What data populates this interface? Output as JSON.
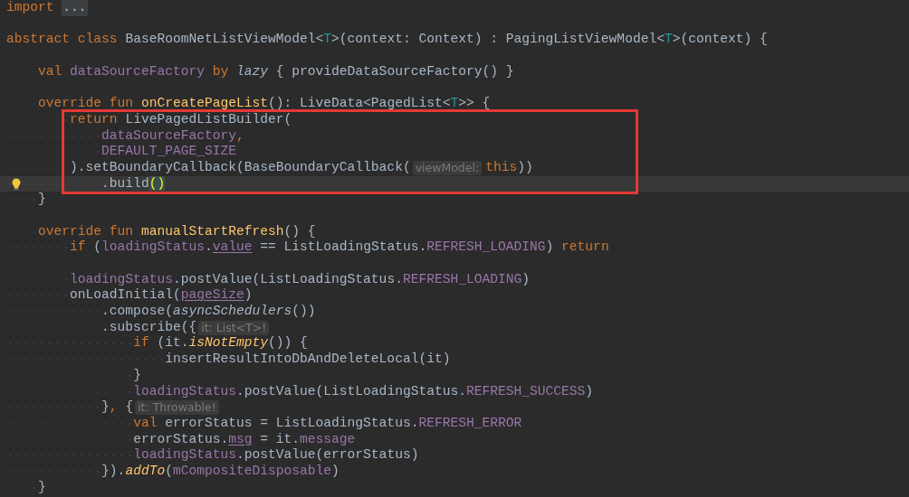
{
  "editor": {
    "blocks": [
      {
        "boxed": false,
        "lines": [
          {
            "current": false,
            "tokens": [
              {
                "kind": "keyword",
                "text": "import "
              },
              {
                "kind": "folded",
                "text": "..."
              }
            ]
          },
          {
            "current": false
          },
          {
            "current": false,
            "tokens": [
              {
                "kind": "keyword",
                "text": "abstract class "
              },
              {
                "kind": "plain",
                "text": "BaseRoomNetListViewModel<"
              },
              {
                "kind": "typeparam",
                "text": "T"
              },
              {
                "kind": "plain",
                "text": ">(context: Context) : PagingListViewModel<"
              },
              {
                "kind": "typeparam",
                "text": "T"
              },
              {
                "kind": "plain",
                "text": ">(context) {"
              }
            ]
          },
          {
            "current": false
          },
          {
            "current": false,
            "tokens": [
              {
                "kind": "keyword",
                "text": "    val "
              },
              {
                "kind": "property",
                "text": "dataSourceFactory"
              },
              {
                "kind": "keyword",
                "text": " by "
              },
              {
                "kind": "italic",
                "text": "lazy"
              },
              {
                "kind": "plain",
                "text": " { provideDataSourceFactory() }"
              }
            ]
          },
          {
            "current": false
          },
          {
            "current": false,
            "tokens": [
              {
                "kind": "keyword",
                "text": "    override fun "
              },
              {
                "kind": "function",
                "text": "onCreatePageList"
              },
              {
                "kind": "plain",
                "text": "(): LiveData<PagedList<"
              },
              {
                "kind": "typeparam",
                "text": "T"
              },
              {
                "kind": "plain",
                "text": ">> {"
              }
            ]
          }
        ]
      },
      {
        "boxed": true,
        "lines": [
          {
            "current": false,
            "tokens": [
              {
                "kind": "keyword",
                "text": "        return "
              },
              {
                "kind": "plain",
                "text": "LivePagedListBuilder("
              }
            ]
          },
          {
            "current": false,
            "tokens": [
              {
                "kind": "property",
                "text": "            dataSourceFactory"
              },
              {
                "kind": "keyword",
                "text": ","
              }
            ]
          },
          {
            "current": false,
            "tokens": [
              {
                "kind": "property",
                "text": "            DEFAULT_PAGE_SIZE"
              }
            ]
          },
          {
            "current": false,
            "tokens": [
              {
                "kind": "plain",
                "text": "        ).setBoundaryCallback(BaseBoundaryCallback("
              },
              {
                "kind": "hint",
                "text": "viewModel:"
              },
              {
                "kind": "keyword",
                "text": "this"
              },
              {
                "kind": "plain",
                "text": "))"
              }
            ]
          },
          {
            "current": true,
            "bulb": true,
            "tokens": [
              {
                "kind": "plain",
                "text": "            .build"
              },
              {
                "kind": "match",
                "text": "()"
              }
            ]
          }
        ]
      },
      {
        "boxed": false,
        "lines": [
          {
            "current": false,
            "tokens": [
              {
                "kind": "plain",
                "text": "    }"
              }
            ]
          },
          {
            "current": false
          },
          {
            "current": false,
            "tokens": [
              {
                "kind": "keyword",
                "text": "    override fun "
              },
              {
                "kind": "function",
                "text": "manualStartRefresh"
              },
              {
                "kind": "plain",
                "text": "() {"
              }
            ]
          },
          {
            "current": false,
            "tokens": [
              {
                "kind": "keyword",
                "text": "        if "
              },
              {
                "kind": "plain",
                "text": "("
              },
              {
                "kind": "property",
                "text": "loadingStatus"
              },
              {
                "kind": "plain",
                "text": "."
              },
              {
                "kind": "property_underlined",
                "text": "value"
              },
              {
                "kind": "plain",
                "text": " == ListLoadingStatus."
              },
              {
                "kind": "property",
                "text": "REFRESH_LOADING"
              },
              {
                "kind": "plain",
                "text": ") "
              },
              {
                "kind": "keyword",
                "text": "return"
              }
            ]
          },
          {
            "current": false
          },
          {
            "current": false,
            "tokens": [
              {
                "kind": "property",
                "text": "        loadingStatus"
              },
              {
                "kind": "plain",
                "text": ".postValue(ListLoadingStatus."
              },
              {
                "kind": "property",
                "text": "REFRESH_LOADING"
              },
              {
                "kind": "plain",
                "text": ")"
              }
            ]
          },
          {
            "current": false,
            "tokens": [
              {
                "kind": "plain",
                "text": "        onLoadInitial("
              },
              {
                "kind": "property_underlined",
                "text": "pageSize"
              },
              {
                "kind": "plain",
                "text": ")"
              }
            ]
          },
          {
            "current": false,
            "tokens": [
              {
                "kind": "plain",
                "text": "            .compose("
              },
              {
                "kind": "italic",
                "text": "asyncSchedulers"
              },
              {
                "kind": "plain",
                "text": "())"
              }
            ]
          },
          {
            "current": false,
            "tokens": [
              {
                "kind": "plain",
                "text": "            .subscribe({"
              },
              {
                "kind": "hint",
                "text": "it: List<T>!"
              }
            ]
          },
          {
            "current": false,
            "tokens": [
              {
                "kind": "keyword",
                "text": "                if "
              },
              {
                "kind": "plain",
                "text": "(it."
              },
              {
                "kind": "extension",
                "text": "isNotEmpty"
              },
              {
                "kind": "plain",
                "text": "()) {"
              }
            ]
          },
          {
            "current": false,
            "tokens": [
              {
                "kind": "plain",
                "text": "                    insertResultIntoDbAndDeleteLocal(it)"
              }
            ]
          },
          {
            "current": false,
            "tokens": [
              {
                "kind": "plain",
                "text": "                }"
              }
            ]
          },
          {
            "current": false,
            "tokens": [
              {
                "kind": "property",
                "text": "                loadingStatus"
              },
              {
                "kind": "plain",
                "text": ".postValue(ListLoadingStatus."
              },
              {
                "kind": "property",
                "text": "REFRESH_SUCCESS"
              },
              {
                "kind": "plain",
                "text": ")"
              }
            ]
          },
          {
            "current": false,
            "tokens": [
              {
                "kind": "plain",
                "text": "            }"
              },
              {
                "kind": "keyword",
                "text": ","
              },
              {
                "kind": "plain",
                "text": " {"
              },
              {
                "kind": "hint",
                "text": "it: Throwable!"
              }
            ]
          },
          {
            "current": false,
            "tokens": [
              {
                "kind": "keyword",
                "text": "                val "
              },
              {
                "kind": "plain",
                "text": "errorStatus = ListLoadingStatus."
              },
              {
                "kind": "property",
                "text": "REFRESH_ERROR"
              }
            ]
          },
          {
            "current": false,
            "tokens": [
              {
                "kind": "plain",
                "text": "                errorStatus."
              },
              {
                "kind": "property_underlined",
                "text": "msg"
              },
              {
                "kind": "plain",
                "text": " = it."
              },
              {
                "kind": "property",
                "text": "message"
              }
            ]
          },
          {
            "current": false,
            "tokens": [
              {
                "kind": "property",
                "text": "                loadingStatus"
              },
              {
                "kind": "plain",
                "text": ".postValue(errorStatus)"
              }
            ]
          },
          {
            "current": false,
            "tokens": [
              {
                "kind": "plain",
                "text": "            })."
              },
              {
                "kind": "extension",
                "text": "addTo"
              },
              {
                "kind": "plain",
                "text": "("
              },
              {
                "kind": "property",
                "text": "mCompositeDisposable"
              },
              {
                "kind": "plain",
                "text": ")"
              }
            ]
          },
          {
            "current": false,
            "tokens": [
              {
                "kind": "plain",
                "text": "    }"
              }
            ]
          }
        ]
      }
    ]
  }
}
